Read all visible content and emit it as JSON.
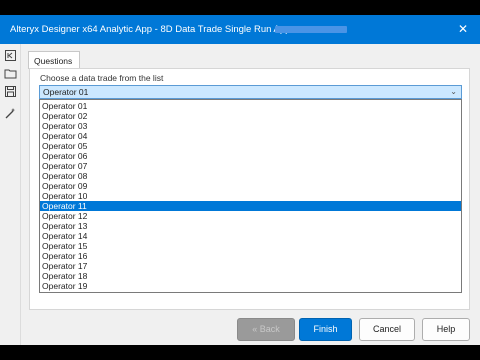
{
  "window": {
    "title": "Alteryx Designer x64 Analytic App - 8D Data Trade Single Run App - ",
    "close_glyph": "✕"
  },
  "toolbar": {
    "icons": [
      "back-to-start-icon",
      "open-folder-icon",
      "save-icon",
      "magic-wand-icon"
    ]
  },
  "tabs": [
    {
      "label": "Questions"
    }
  ],
  "question": {
    "label": "Choose a data trade from the list",
    "selected_value": "Operator 01",
    "arrow_glyph": "⌄",
    "highlighted_option": "Operator 11",
    "options": [
      "Operator 01",
      "Operator 02",
      "Operator 03",
      "Operator 04",
      "Operator 05",
      "Operator 06",
      "Operator 07",
      "Operator 08",
      "Operator 09",
      "Operator 10",
      "Operator 11",
      "Operator 12",
      "Operator 13",
      "Operator 14",
      "Operator 15",
      "Operator 16",
      "Operator 17",
      "Operator 18",
      "Operator 19"
    ]
  },
  "buttons": {
    "back": "« Back",
    "finish": "Finish",
    "cancel": "Cancel",
    "help": "Help"
  },
  "colors": {
    "titlebar": "#0078d7",
    "selection": "#0078d7",
    "combo_fill": "#cce8ff"
  }
}
